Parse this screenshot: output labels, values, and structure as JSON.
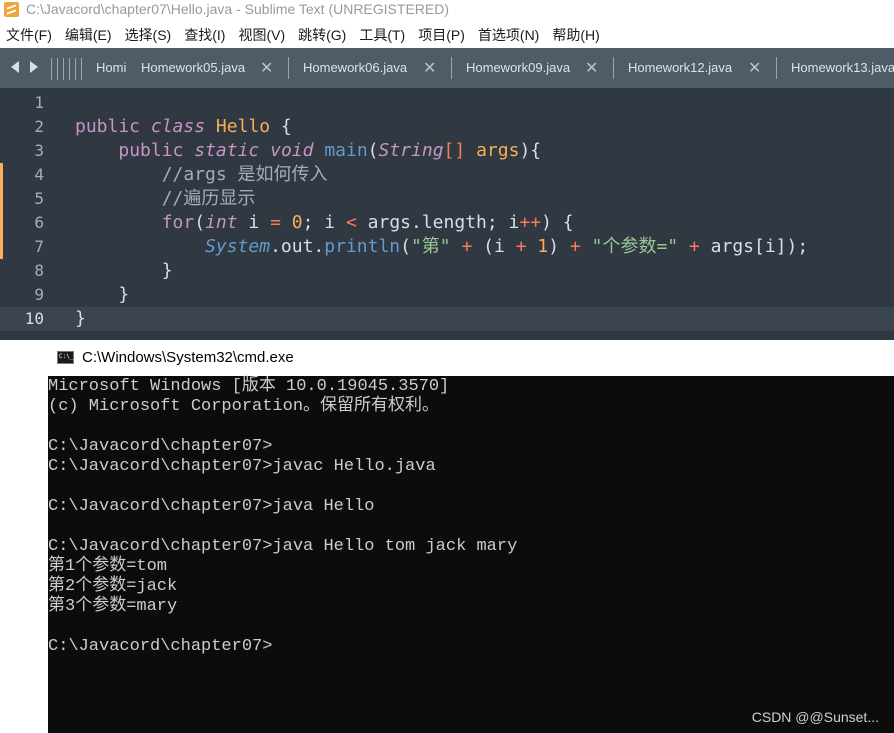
{
  "titlebar": {
    "title": "C:\\Javacord\\chapter07\\Hello.java - Sublime Text (UNREGISTERED)"
  },
  "menu": [
    "文件(F)",
    "编辑(E)",
    "选择(S)",
    "查找(I)",
    "视图(V)",
    "跳转(G)",
    "工具(T)",
    "项目(P)",
    "首选项(N)",
    "帮助(H)"
  ],
  "tabs": [
    "Homi",
    "Homework05.java",
    "Homework06.java",
    "Homework09.java",
    "Homework12.java",
    "Homework13.java"
  ],
  "tab_close_glyph": "✕",
  "editor": {
    "current_line": 10,
    "modified_lines": [
      4,
      5,
      6,
      7
    ],
    "lines": [
      {
        "num": "1",
        "text": ""
      },
      {
        "num": "2",
        "text": "public class Hello {"
      },
      {
        "num": "3",
        "text": "    public static void main(String[] args){"
      },
      {
        "num": "4",
        "text": "        //args 是如何传入"
      },
      {
        "num": "5",
        "text": "        //遍历显示"
      },
      {
        "num": "6",
        "text": "        for(int i = 0; i < args.length; i++) {"
      },
      {
        "num": "7",
        "text": "            System.out.println(\"第\" + (i + 1) + \"个参数=\" + args[i]);"
      },
      {
        "num": "8",
        "text": "        }"
      },
      {
        "num": "9",
        "text": "    }"
      },
      {
        "num": "10",
        "text": "}"
      }
    ]
  },
  "cmd": {
    "title": "C:\\Windows\\System32\\cmd.exe",
    "lines": [
      "Microsoft Windows [版本 10.0.19045.3570]",
      "(c) Microsoft Corporation。保留所有权利。",
      "",
      "C:\\Javacord\\chapter07>",
      "C:\\Javacord\\chapter07>javac Hello.java",
      "",
      "C:\\Javacord\\chapter07>java Hello",
      "",
      "C:\\Javacord\\chapter07>java Hello tom jack mary",
      "第1个参数=tom",
      "第2个参数=jack",
      "第3个参数=mary",
      "",
      "C:\\Javacord\\chapter07>"
    ],
    "watermark": "CSDN @@Sunset..."
  },
  "colors": {
    "editor_bg": "#303841",
    "tab_bg": "#4f5b66",
    "keyword": "#c695c6",
    "class_name": "#f9ae58",
    "function": "#6699cc",
    "string": "#99c794",
    "operator": "#f97b58",
    "comment": "#a6acb9",
    "terminal_bg": "#0c0c0c",
    "terminal_fg": "#cccccc"
  }
}
